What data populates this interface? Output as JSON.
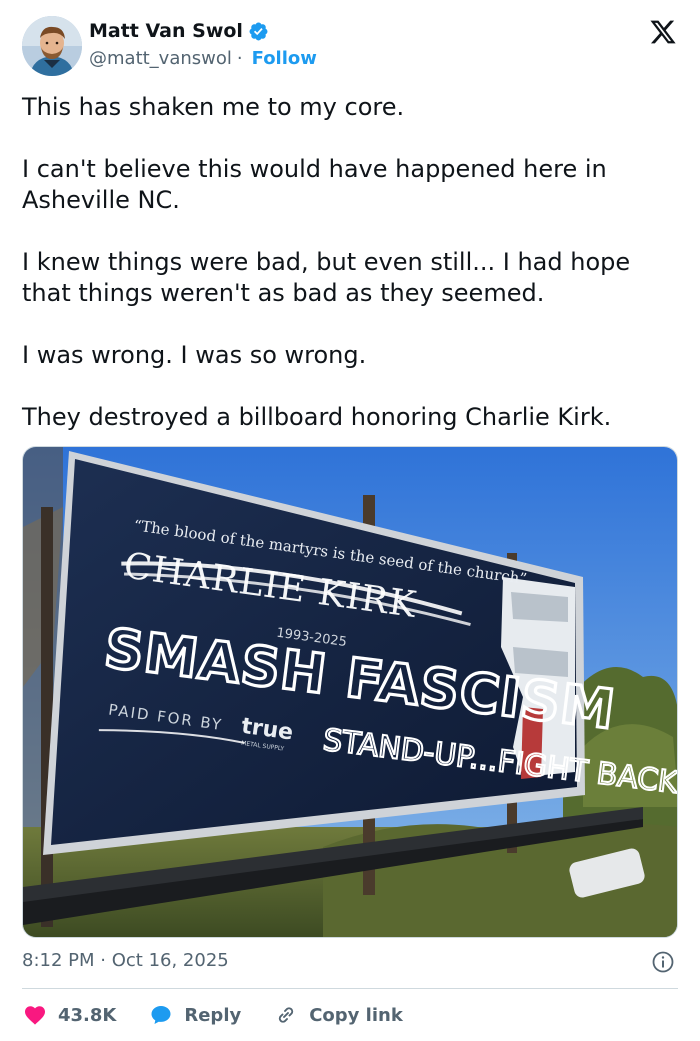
{
  "author": {
    "display_name": "Matt Van Swol",
    "handle": "@matt_vanswol",
    "separator": "·",
    "follow_label": "Follow",
    "verified": true
  },
  "brand_icon": "x-logo-icon",
  "tweet": {
    "paragraphs": [
      "This has shaken me to my core.",
      "I can't believe this would have happened here in Asheville NC.",
      "I knew things were bad, but even still... I had hope that things weren't as bad as they seemed.",
      "I was wrong. I was so wrong.",
      "They destroyed a billboard honoring Charlie Kirk."
    ]
  },
  "media": {
    "billboard": {
      "quote": "“The blood of the martyrs is the seed of the church”",
      "name": "CHARLIE KIRK",
      "years": "1993-2025",
      "paid_for": "PAID FOR BY",
      "sponsor": "true",
      "sponsor_sub": "METAL SUPPLY",
      "graffiti_main": "SMASH FASCISM",
      "graffiti_sub": "STAND-UP...FIGHT BACK"
    }
  },
  "meta": {
    "time": "8:12 PM",
    "separator": "·",
    "date": "Oct 16, 2025"
  },
  "actions": {
    "like_count": "43.8K",
    "reply_label": "Reply",
    "copy_label": "Copy link"
  },
  "colors": {
    "accent": "#1d9bf0",
    "like": "#f91880",
    "text": "#0f1419",
    "muted": "#536471"
  }
}
